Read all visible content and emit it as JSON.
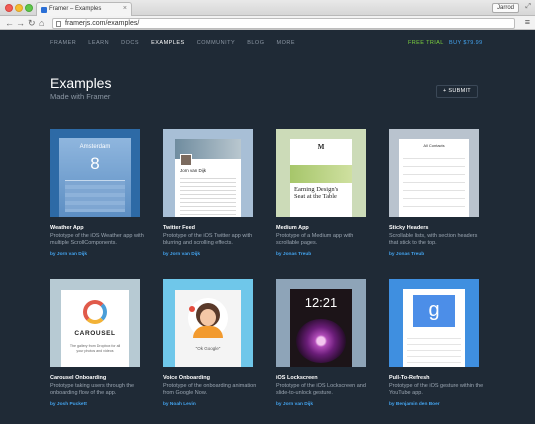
{
  "browser": {
    "tab_title": "Framer – Examples",
    "tab_close": "×",
    "user_button": "Jarrod",
    "url": "framerjs.com/examples/",
    "icons": [
      "back-arrow-icon",
      "forward-arrow-icon",
      "reload-icon",
      "home-icon",
      "page-icon",
      "menu-icon"
    ]
  },
  "nav": {
    "items": [
      "FRAMER",
      "LEARN",
      "DOCS",
      "EXAMPLES",
      "COMMUNITY",
      "BLOG",
      "MORE"
    ],
    "active": "EXAMPLES",
    "free_trial": "FREE TRIAL",
    "buy": "BUY $79.99"
  },
  "header": {
    "title": "Examples",
    "subtitle": "Made with Framer",
    "submit_label": "+ SUBMIT"
  },
  "cards": [
    {
      "title": "Weather App",
      "description": "Prototype of the iOS Weather app with multiple ScrollComponents.",
      "author": "by Jorn van Dijk",
      "thumb": {
        "city": "Amsterdam",
        "temp": "8"
      }
    },
    {
      "title": "Twitter Feed",
      "description": "Prototype of the iOS Twitter app with blurring and scrolling effects.",
      "author": "by Jorn van Dijk",
      "thumb": {
        "name": "Jorn van Dijk"
      }
    },
    {
      "title": "Medium App",
      "description": "Prototype of a Medium app with scrollable pages.",
      "author": "by Jonas Treub",
      "thumb": {
        "logo": "M",
        "headline": "Earning Design's Seat at the Table"
      }
    },
    {
      "title": "Sticky Headers",
      "description": "Scrollable lists, with section headers that stick to the top.",
      "author": "by Jonas Treub",
      "thumb": {
        "header": "All Contacts"
      }
    },
    {
      "title": "Carousel Onboarding",
      "description": "Prototype taking users through the onboarding flow of the app.",
      "author": "by Josh Puckett",
      "thumb": {
        "label": "CAROUSEL",
        "caption": "The gallery from Dropbox for all your photos and videos"
      }
    },
    {
      "title": "Voice Onboarding",
      "description": "Prototype of the onboarding animation from Google Now.",
      "author": "by Noah Levin",
      "thumb": {
        "caption": "\"Ok Google\""
      }
    },
    {
      "title": "iOS Lockscreen",
      "description": "Prototype of the iOS Lockscreen and slide-to-unlock gesture.",
      "author": "by Jorn van Dijk",
      "thumb": {
        "time": "12:21"
      }
    },
    {
      "title": "Pull-To-Refresh",
      "description": "Prototype of the iOS gesture within the YouTube app.",
      "author": "by Benjamin den Boer",
      "thumb": {
        "logo": "g"
      }
    }
  ]
}
